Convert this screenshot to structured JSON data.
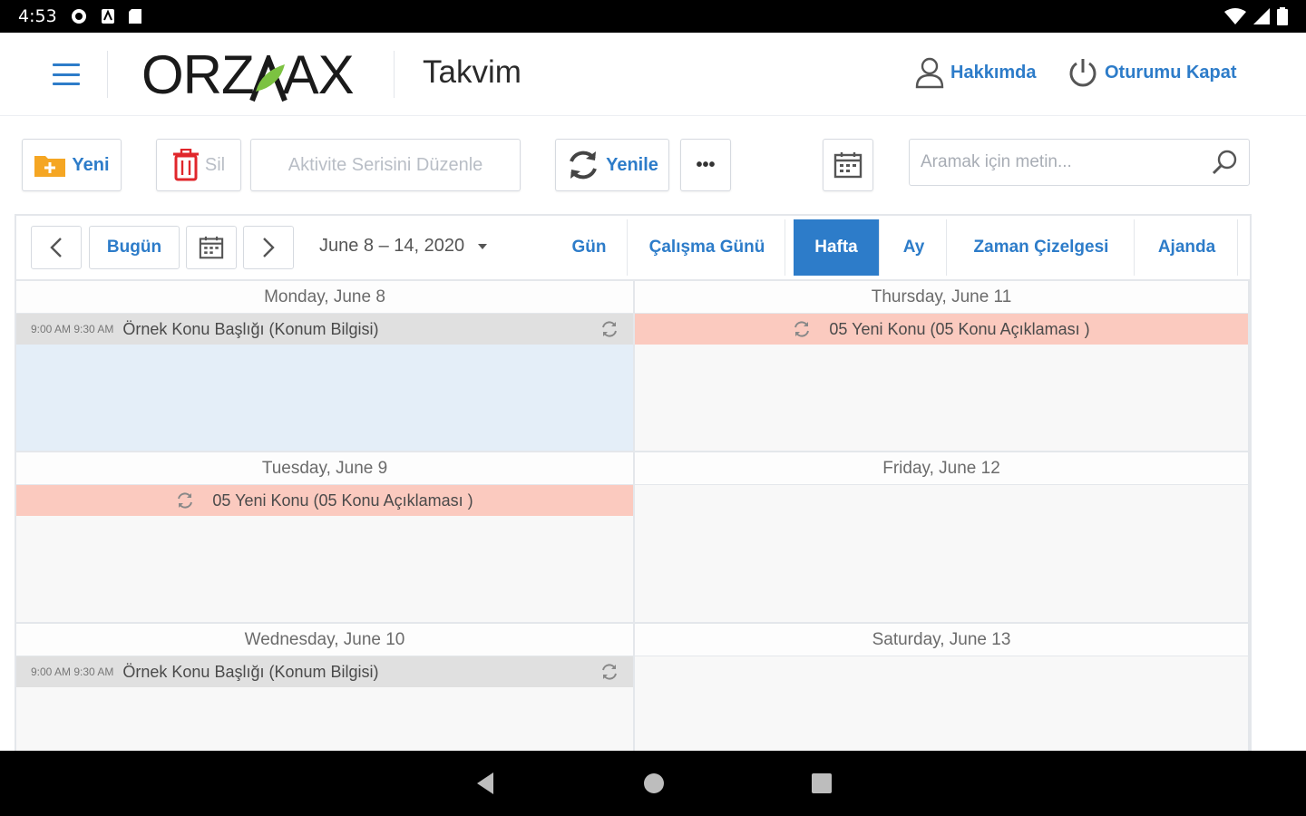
{
  "status_bar": {
    "time": "4:53"
  },
  "header": {
    "logo_left": "ORZ",
    "logo_right": "AX",
    "title": "Takvim",
    "about_label": "Hakkımda",
    "logout_label": "Oturumu Kapat"
  },
  "toolbar": {
    "new_label": "Yeni",
    "delete_label": "Sil",
    "edit_series_label": "Aktivite Serisini Düzenle",
    "refresh_label": "Yenile",
    "more_label": "•••",
    "search_placeholder": "Aramak için metin..."
  },
  "calendar": {
    "today_label": "Bugün",
    "date_range": "June 8 – 14, 2020",
    "views": [
      "Gün",
      "Çalışma Günü",
      "Hafta",
      "Ay",
      "Zaman Çizelgesi",
      "Ajanda"
    ],
    "active_view": "Hafta",
    "days": [
      {
        "header": "Monday, June 8",
        "event": {
          "time": "9:00 AM 9:30 AM",
          "title": "Örnek Konu Başlığı (Konum Bilgisi)",
          "style": "gray"
        }
      },
      {
        "header": "Tuesday, June 9",
        "event": {
          "title": "05 Yeni Konu (05 Konu Açıklaması )",
          "style": "pink"
        }
      },
      {
        "header": "Wednesday, June 10",
        "event": {
          "time": "9:00 AM 9:30 AM",
          "title": "Örnek Konu Başlığı (Konum Bilgisi)",
          "style": "gray"
        }
      },
      {
        "header": "Thursday, June 11",
        "event": {
          "title": "05 Yeni Konu (05 Konu Açıklaması )",
          "style": "pink"
        }
      },
      {
        "header": "Friday, June 12"
      },
      {
        "header": "Saturday, June 13"
      }
    ]
  },
  "colors": {
    "accent": "#2d7cc9",
    "event_gray": "#e0e0e0",
    "event_pink": "#fbcabf",
    "selected": "#e4eef8",
    "logo_leaf": "#7cc241"
  }
}
